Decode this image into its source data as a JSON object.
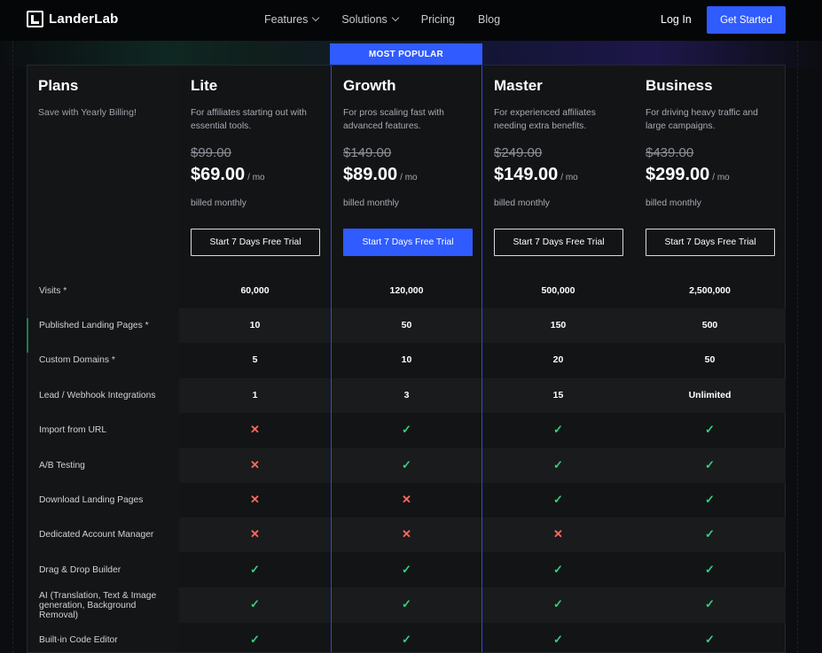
{
  "nav": {
    "logo": "LanderLab",
    "links": [
      {
        "label": "Features",
        "dropdown": true
      },
      {
        "label": "Solutions",
        "dropdown": true
      },
      {
        "label": "Pricing",
        "dropdown": false
      },
      {
        "label": "Blog",
        "dropdown": false
      }
    ],
    "login": "Log In",
    "cta": "Get Started"
  },
  "pricing": {
    "title": "Plans",
    "subtitle": "Save with Yearly Billing!",
    "popular_tag": "MOST POPULAR",
    "plans": [
      {
        "name": "Lite",
        "desc": "For affiliates starting out with essential tools.",
        "old_price": "$99.00",
        "price": "$69.00",
        "per": "/ mo",
        "billed": "billed monthly",
        "button": "Start 7 Days Free Trial",
        "popular": false
      },
      {
        "name": "Growth",
        "desc": "For pros scaling fast with advanced features.",
        "old_price": "$149.00",
        "price": "$89.00",
        "per": "/ mo",
        "billed": "billed monthly",
        "button": "Start 7 Days Free Trial",
        "popular": true
      },
      {
        "name": "Master",
        "desc": "For experienced affiliates needing extra benefits.",
        "old_price": "$249.00",
        "price": "$149.00",
        "per": "/ mo",
        "billed": "billed monthly",
        "button": "Start 7 Days Free Trial",
        "popular": false
      },
      {
        "name": "Business",
        "desc": "For driving heavy traffic and large campaigns.",
        "old_price": "$439.00",
        "price": "$299.00",
        "per": "/ mo",
        "billed": "billed monthly",
        "button": "Start 7 Days Free Trial",
        "popular": false
      }
    ],
    "features": [
      {
        "label": "Visits *",
        "values": [
          "60,000",
          "120,000",
          "500,000",
          "2,500,000"
        ]
      },
      {
        "label": "Published Landing Pages *",
        "values": [
          "10",
          "50",
          "150",
          "500"
        ]
      },
      {
        "label": "Custom Domains *",
        "values": [
          "5",
          "10",
          "20",
          "50"
        ]
      },
      {
        "label": "Lead / Webhook Integrations",
        "values": [
          "1",
          "3",
          "15",
          "Unlimited"
        ]
      },
      {
        "label": "Import from URL",
        "values": [
          "no",
          "yes",
          "yes",
          "yes"
        ]
      },
      {
        "label": "A/B Testing",
        "values": [
          "no",
          "yes",
          "yes",
          "yes"
        ]
      },
      {
        "label": "Download Landing Pages",
        "values": [
          "no",
          "no",
          "yes",
          "yes"
        ]
      },
      {
        "label": "Dedicated Account Manager",
        "values": [
          "no",
          "no",
          "no",
          "yes"
        ]
      },
      {
        "label": "Drag & Drop Builder",
        "values": [
          "yes",
          "yes",
          "yes",
          "yes"
        ]
      },
      {
        "label": "AI (Translation, Text & Image generation, Background Removal)",
        "values": [
          "yes",
          "yes",
          "yes",
          "yes"
        ]
      },
      {
        "label": "Built-in Code Editor",
        "values": [
          "yes",
          "yes",
          "yes",
          "yes"
        ]
      }
    ]
  },
  "colors": {
    "accent": "#2f5bff",
    "check": "#35d07f",
    "cross": "#ff6b5b"
  }
}
